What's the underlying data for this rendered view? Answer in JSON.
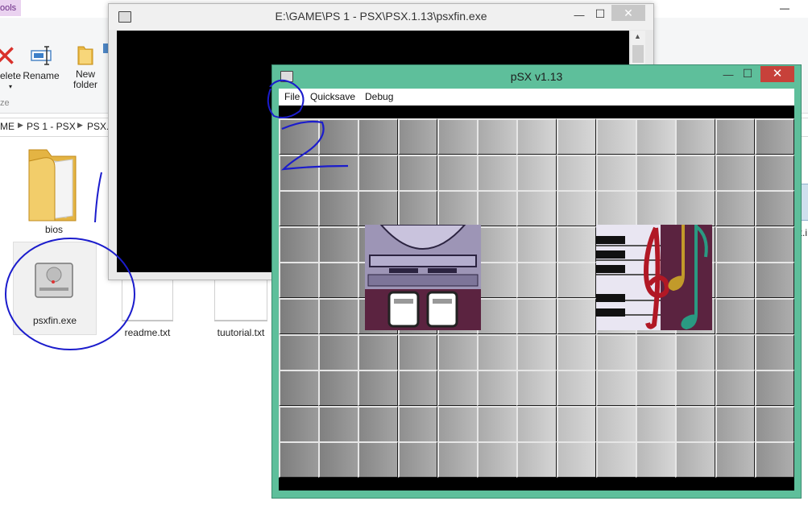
{
  "explorer": {
    "ribbon_tab_tools": "ools",
    "delete_label": "elete",
    "rename_label": "Rename",
    "new_folder_label_line1": "New",
    "new_folder_label_line2": "folder",
    "group_caption": "ze",
    "breadcrumb": [
      "ME",
      "PS 1 - PSX",
      "PSX.1"
    ],
    "files": [
      {
        "name": "bios",
        "type": "folder"
      },
      {
        "name": "psxfin.exe",
        "type": "application",
        "selected": true
      },
      {
        "name": "readme.txt",
        "type": "text"
      },
      {
        "name": "tuutorial.txt",
        "type": "text"
      }
    ],
    "right_partial_label": "x.i",
    "window_controls": {
      "minimize": "—",
      "maximize": "☐"
    }
  },
  "console_window": {
    "title": "E:\\GAME\\PS 1 - PSX\\PSX.1.13\\psxfin.exe",
    "controls": {
      "minimize": "—",
      "maximize": "☐",
      "close": "✕"
    }
  },
  "psx_window": {
    "title": "pSX v1.13",
    "controls": {
      "minimize": "—",
      "maximize": "☐",
      "close": "✕"
    },
    "menu": [
      "File",
      "Quicksave",
      "Debug"
    ]
  },
  "annotations": {
    "step1": "1",
    "step2": "2",
    "color": "#1b1ccc"
  },
  "colors": {
    "psx_frame": "#5ebf9b",
    "psx_close": "#c7413a",
    "card_bg": "#5b2340"
  }
}
